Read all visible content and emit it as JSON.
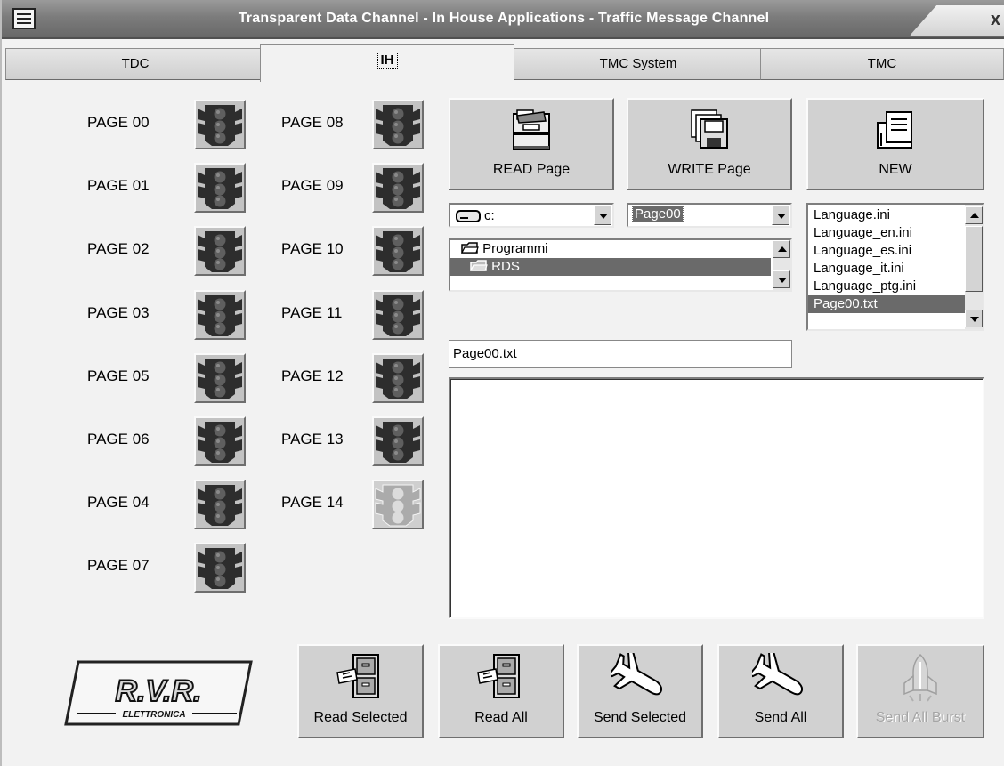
{
  "window": {
    "title": "Transparent Data Channel - In House Applications - Traffic Message Channel",
    "close_glyph": "x"
  },
  "tabs": [
    {
      "label": "TDC"
    },
    {
      "label": "IH"
    },
    {
      "label": "TMC System"
    },
    {
      "label": "TMC"
    }
  ],
  "active_tab": "IH",
  "pages_left": [
    {
      "label": "PAGE 00",
      "state": "active"
    },
    {
      "label": "PAGE 01",
      "state": "active"
    },
    {
      "label": "PAGE 02",
      "state": "active"
    },
    {
      "label": "PAGE 03",
      "state": "active"
    },
    {
      "label": "PAGE 05",
      "state": "active"
    },
    {
      "label": "PAGE 06",
      "state": "active"
    },
    {
      "label": "PAGE 04",
      "state": "active"
    },
    {
      "label": "PAGE 07",
      "state": "active"
    }
  ],
  "pages_right": [
    {
      "label": "PAGE 08",
      "state": "active"
    },
    {
      "label": "PAGE 09",
      "state": "active"
    },
    {
      "label": "PAGE 10",
      "state": "active"
    },
    {
      "label": "PAGE 11",
      "state": "active"
    },
    {
      "label": "PAGE 12",
      "state": "active"
    },
    {
      "label": "PAGE 13",
      "state": "active"
    },
    {
      "label": "PAGE 14",
      "state": "disabled"
    }
  ],
  "file_buttons": {
    "read_page": "READ Page",
    "write_page": "WRITE Page",
    "new": "NEW"
  },
  "drive_combo": {
    "value": "c:",
    "icon": "drive-icon"
  },
  "name_combo": {
    "value": "Page00"
  },
  "folders": [
    {
      "label": "Programmi",
      "selected": false
    },
    {
      "label": "RDS",
      "selected": true
    }
  ],
  "files": [
    {
      "label": "Language.ini",
      "selected": false
    },
    {
      "label": "Language_en.ini",
      "selected": false
    },
    {
      "label": "Language_es.ini",
      "selected": false
    },
    {
      "label": "Language_it.ini",
      "selected": false
    },
    {
      "label": "Language_ptg.ini",
      "selected": false
    },
    {
      "label": "Page00.txt",
      "selected": true
    }
  ],
  "filename_field": {
    "value": "Page00.txt"
  },
  "content_area": {
    "value": ""
  },
  "logo": {
    "letters": "R.V.R.",
    "subtitle": "ELETTRONICA"
  },
  "action_buttons": [
    {
      "label": "Read Selected",
      "icon": "cabinet-icon",
      "enabled": true
    },
    {
      "label": "Read All",
      "icon": "cabinet-icon",
      "enabled": true
    },
    {
      "label": "Send Selected",
      "icon": "airplane-icon",
      "enabled": true
    },
    {
      "label": "Send All",
      "icon": "airplane-icon",
      "enabled": true
    },
    {
      "label": "Send All Burst",
      "icon": "shuttle-icon",
      "enabled": false
    }
  ],
  "colors": {
    "window_bg": "#f2f2f2",
    "selection": "#6a6a6a",
    "light_body": "#2e2e2e",
    "lamp": "#5a5a5a"
  }
}
